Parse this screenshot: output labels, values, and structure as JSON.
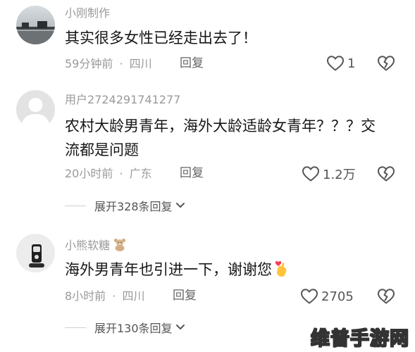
{
  "comments": [
    {
      "username": "小刚制作",
      "content_lines": [
        "其实很多女性已经走出去了！"
      ],
      "time": "59分钟前",
      "location": "四川",
      "reply_label": "回复",
      "likes": "1"
    },
    {
      "username": "用户2724291741277",
      "content_lines": [
        "农村大龄男青年，海外大龄适龄女青年？？？交",
        "流都是问题"
      ],
      "time": "20小时前",
      "location": "广东",
      "reply_label": "回复",
      "likes": "1.2万",
      "expand_label": "展开328条回复"
    },
    {
      "username": "小熊软糖",
      "content_lines": [
        "海外男青年也引进一下，谢谢您"
      ],
      "time": "8小时前",
      "location": "四川",
      "reply_label": "回复",
      "likes": "2705",
      "expand_label": "展开130条回复"
    }
  ],
  "meta_separator": "·",
  "watermark": "维普手游网",
  "colors": {
    "text_primary": "#161616",
    "text_secondary": "#9a9a9a",
    "icon": "#555555"
  }
}
